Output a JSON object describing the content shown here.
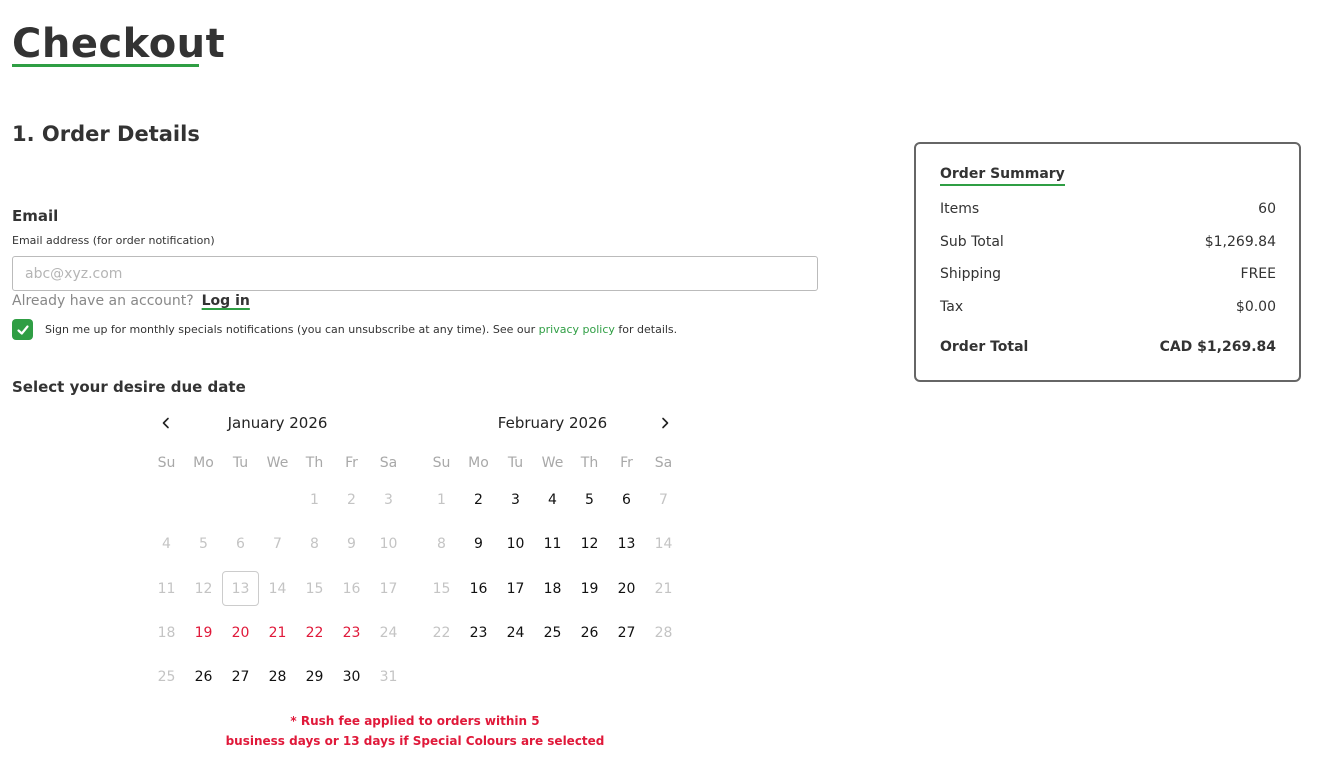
{
  "page": {
    "title": "Checkout",
    "section_title": "1. Order Details"
  },
  "email": {
    "label": "Email",
    "sublabel": "Email address (for order notification)",
    "placeholder": "abc@xyz.com",
    "value": ""
  },
  "account": {
    "prompt": "Already have an account?",
    "login_label": "Log in"
  },
  "newsletter": {
    "checked": true,
    "text_before": "Sign me up for monthly specials notifications (you can unsubscribe at any time). See our",
    "link_label": "privacy policy",
    "text_after": "for details."
  },
  "due_date": {
    "label": "Select your desire due date",
    "prev_icon": "chevron-left-icon",
    "next_icon": "chevron-right-icon",
    "weekday_labels": [
      "Su",
      "Mo",
      "Tu",
      "We",
      "Th",
      "Fr",
      "Sa"
    ],
    "months": [
      {
        "title": "January 2026",
        "weeks": [
          [
            null,
            null,
            null,
            null,
            {
              "d": "1",
              "s": "disabled"
            },
            {
              "d": "2",
              "s": "disabled"
            },
            {
              "d": "3",
              "s": "disabled"
            }
          ],
          [
            {
              "d": "4",
              "s": "disabled"
            },
            {
              "d": "5",
              "s": "disabled"
            },
            {
              "d": "6",
              "s": "disabled"
            },
            {
              "d": "7",
              "s": "disabled"
            },
            {
              "d": "8",
              "s": "disabled"
            },
            {
              "d": "9",
              "s": "disabled"
            },
            {
              "d": "10",
              "s": "disabled"
            }
          ],
          [
            {
              "d": "11",
              "s": "disabled"
            },
            {
              "d": "12",
              "s": "disabled"
            },
            {
              "d": "13",
              "s": "today"
            },
            {
              "d": "14",
              "s": "disabled"
            },
            {
              "d": "15",
              "s": "disabled"
            },
            {
              "d": "16",
              "s": "disabled"
            },
            {
              "d": "17",
              "s": "disabled"
            }
          ],
          [
            {
              "d": "18",
              "s": "disabled"
            },
            {
              "d": "19",
              "s": "rush"
            },
            {
              "d": "20",
              "s": "rush"
            },
            {
              "d": "21",
              "s": "rush"
            },
            {
              "d": "22",
              "s": "rush"
            },
            {
              "d": "23",
              "s": "rush"
            },
            {
              "d": "24",
              "s": "disabled"
            }
          ],
          [
            {
              "d": "25",
              "s": "disabled"
            },
            {
              "d": "26",
              "s": "enabled"
            },
            {
              "d": "27",
              "s": "enabled"
            },
            {
              "d": "28",
              "s": "enabled"
            },
            {
              "d": "29",
              "s": "enabled"
            },
            {
              "d": "30",
              "s": "enabled"
            },
            {
              "d": "31",
              "s": "disabled"
            }
          ]
        ]
      },
      {
        "title": "February 2026",
        "weeks": [
          [
            {
              "d": "1",
              "s": "disabled"
            },
            {
              "d": "2",
              "s": "enabled"
            },
            {
              "d": "3",
              "s": "enabled"
            },
            {
              "d": "4",
              "s": "enabled"
            },
            {
              "d": "5",
              "s": "enabled"
            },
            {
              "d": "6",
              "s": "enabled"
            },
            {
              "d": "7",
              "s": "disabled"
            }
          ],
          [
            {
              "d": "8",
              "s": "disabled"
            },
            {
              "d": "9",
              "s": "enabled"
            },
            {
              "d": "10",
              "s": "enabled"
            },
            {
              "d": "11",
              "s": "enabled"
            },
            {
              "d": "12",
              "s": "enabled"
            },
            {
              "d": "13",
              "s": "enabled"
            },
            {
              "d": "14",
              "s": "disabled"
            }
          ],
          [
            {
              "d": "15",
              "s": "disabled"
            },
            {
              "d": "16",
              "s": "enabled"
            },
            {
              "d": "17",
              "s": "enabled"
            },
            {
              "d": "18",
              "s": "enabled"
            },
            {
              "d": "19",
              "s": "enabled"
            },
            {
              "d": "20",
              "s": "enabled"
            },
            {
              "d": "21",
              "s": "disabled"
            }
          ],
          [
            {
              "d": "22",
              "s": "disabled"
            },
            {
              "d": "23",
              "s": "enabled"
            },
            {
              "d": "24",
              "s": "enabled"
            },
            {
              "d": "25",
              "s": "enabled"
            },
            {
              "d": "26",
              "s": "enabled"
            },
            {
              "d": "27",
              "s": "enabled"
            },
            {
              "d": "28",
              "s": "disabled"
            }
          ]
        ]
      }
    ],
    "rush_note_line1": "* Rush fee applied to orders within 5",
    "rush_note_line2": "business days or 13 days if Special Colours are selected"
  },
  "summary": {
    "title": "Order Summary",
    "rows": [
      {
        "label": "Items",
        "value": "60"
      },
      {
        "label": "Sub Total",
        "value": "$1,269.84"
      },
      {
        "label": "Shipping",
        "value": "FREE"
      },
      {
        "label": "Tax",
        "value": "$0.00"
      }
    ],
    "total_label": "Order Total",
    "total_value": "CAD $1,269.84"
  },
  "colors": {
    "accent": "#2f9e44",
    "rush": "#e0193a",
    "text": "#333333",
    "muted": "#c4c4c4"
  }
}
